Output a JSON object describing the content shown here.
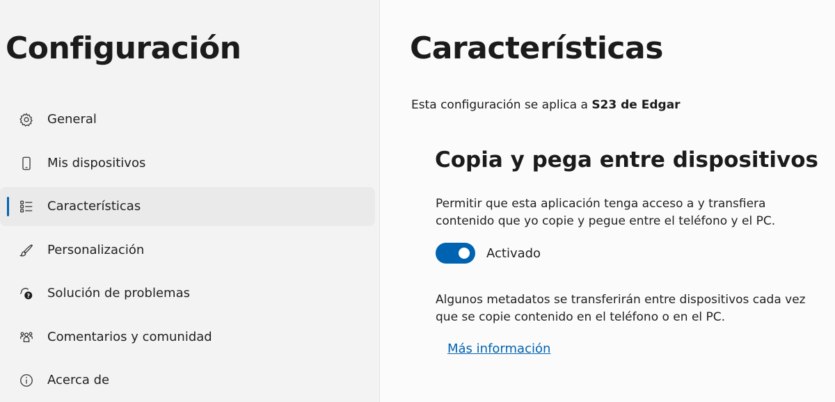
{
  "sidebar": {
    "title": "Configuración",
    "items": [
      {
        "label": "General",
        "icon": "gear-icon",
        "selected": false
      },
      {
        "label": "Mis dispositivos",
        "icon": "phone-icon",
        "selected": false
      },
      {
        "label": "Características",
        "icon": "list-icon",
        "selected": true
      },
      {
        "label": "Personalización",
        "icon": "brush-icon",
        "selected": false
      },
      {
        "label": "Solución de problemas",
        "icon": "troubleshoot-icon",
        "selected": false
      },
      {
        "label": "Comentarios y comunidad",
        "icon": "community-icon",
        "selected": false
      },
      {
        "label": "Acerca de",
        "icon": "info-icon",
        "selected": false
      }
    ]
  },
  "main": {
    "title": "Características",
    "applies_prefix": "Esta configuración se aplica a",
    "device_name": "S23 de Edgar",
    "section": {
      "title": "Copia y pega entre dispositivos",
      "description": "Permitir que esta aplicación tenga acceso a y transfiera contenido que yo copie y pegue entre el teléfono y el PC.",
      "toggle_state": true,
      "toggle_label": "Activado",
      "note": "Algunos metadatos se transferirán entre dispositivos cada vez que se copie contenido en el teléfono o en el PC.",
      "link": "Más información"
    }
  },
  "colors": {
    "accent": "#0063b1",
    "sidebar_bg": "#f3f3f3",
    "main_bg": "#fbfbfb"
  }
}
